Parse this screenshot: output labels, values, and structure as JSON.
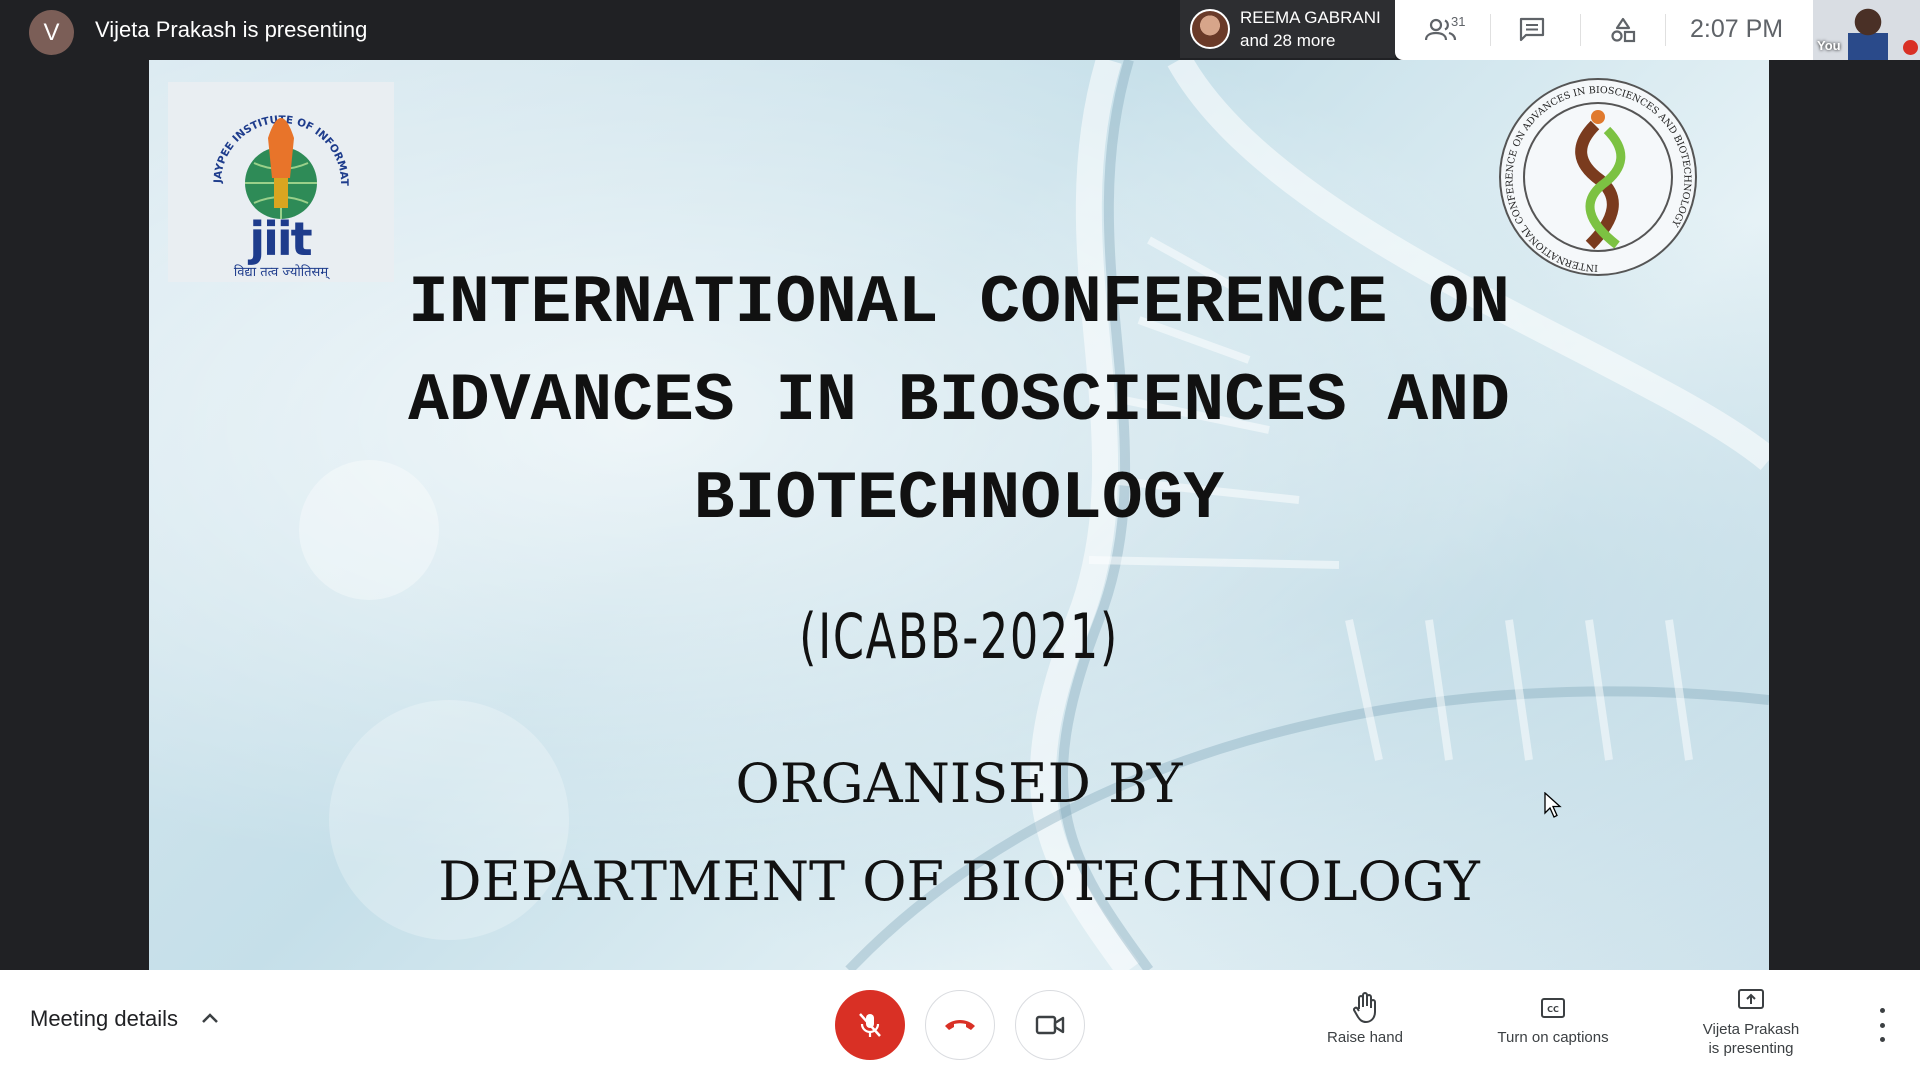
{
  "top_bar": {
    "presenter_initial": "V",
    "presenter_text": "Vijeta Prakash is presenting",
    "participant_chip": {
      "name": "REEMA GABRANI",
      "more": "and 28 more"
    },
    "participants_count": "31",
    "time": "2:07 PM",
    "self_label": "You"
  },
  "slide": {
    "logo_left": {
      "word": "jiit",
      "arc_text": "JAYPEE INSTITUTE OF INFORMATION TECHNOLOGY",
      "motto": "विद्या तत्व ज्योतिसम्"
    },
    "logo_right": {
      "arc_text": "INTERNATIONAL CONFERENCE ON ADVANCES IN BIOSCIENCES AND BIOTECHNOLOGY"
    },
    "title_lines": [
      "INTERNATIONAL CONFERENCE ON",
      "ADVANCES IN BIOSCIENCES AND",
      "BIOTECHNOLOGY"
    ],
    "abbreviation": "(ICABB-2021)",
    "organised_by": "ORGANISED BY",
    "department": "DEPARTMENT OF BIOTECHNOLOGY"
  },
  "bottom_bar": {
    "meeting_details": "Meeting details",
    "raise_hand": "Raise hand",
    "captions": "Turn on captions",
    "present_line1": "Vijeta Prakash",
    "present_line2": "is presenting"
  },
  "colors": {
    "mic_off": "#d93025",
    "end_call_icon": "#d93025",
    "bar_dark": "#202124"
  },
  "icons": [
    "people-icon",
    "chat-icon",
    "activities-icon",
    "mic-off-icon",
    "call-end-icon",
    "camera-icon",
    "hand-icon",
    "captions-icon",
    "present-icon",
    "more-vert-icon",
    "chevron-up-icon",
    "cursor-icon"
  ]
}
